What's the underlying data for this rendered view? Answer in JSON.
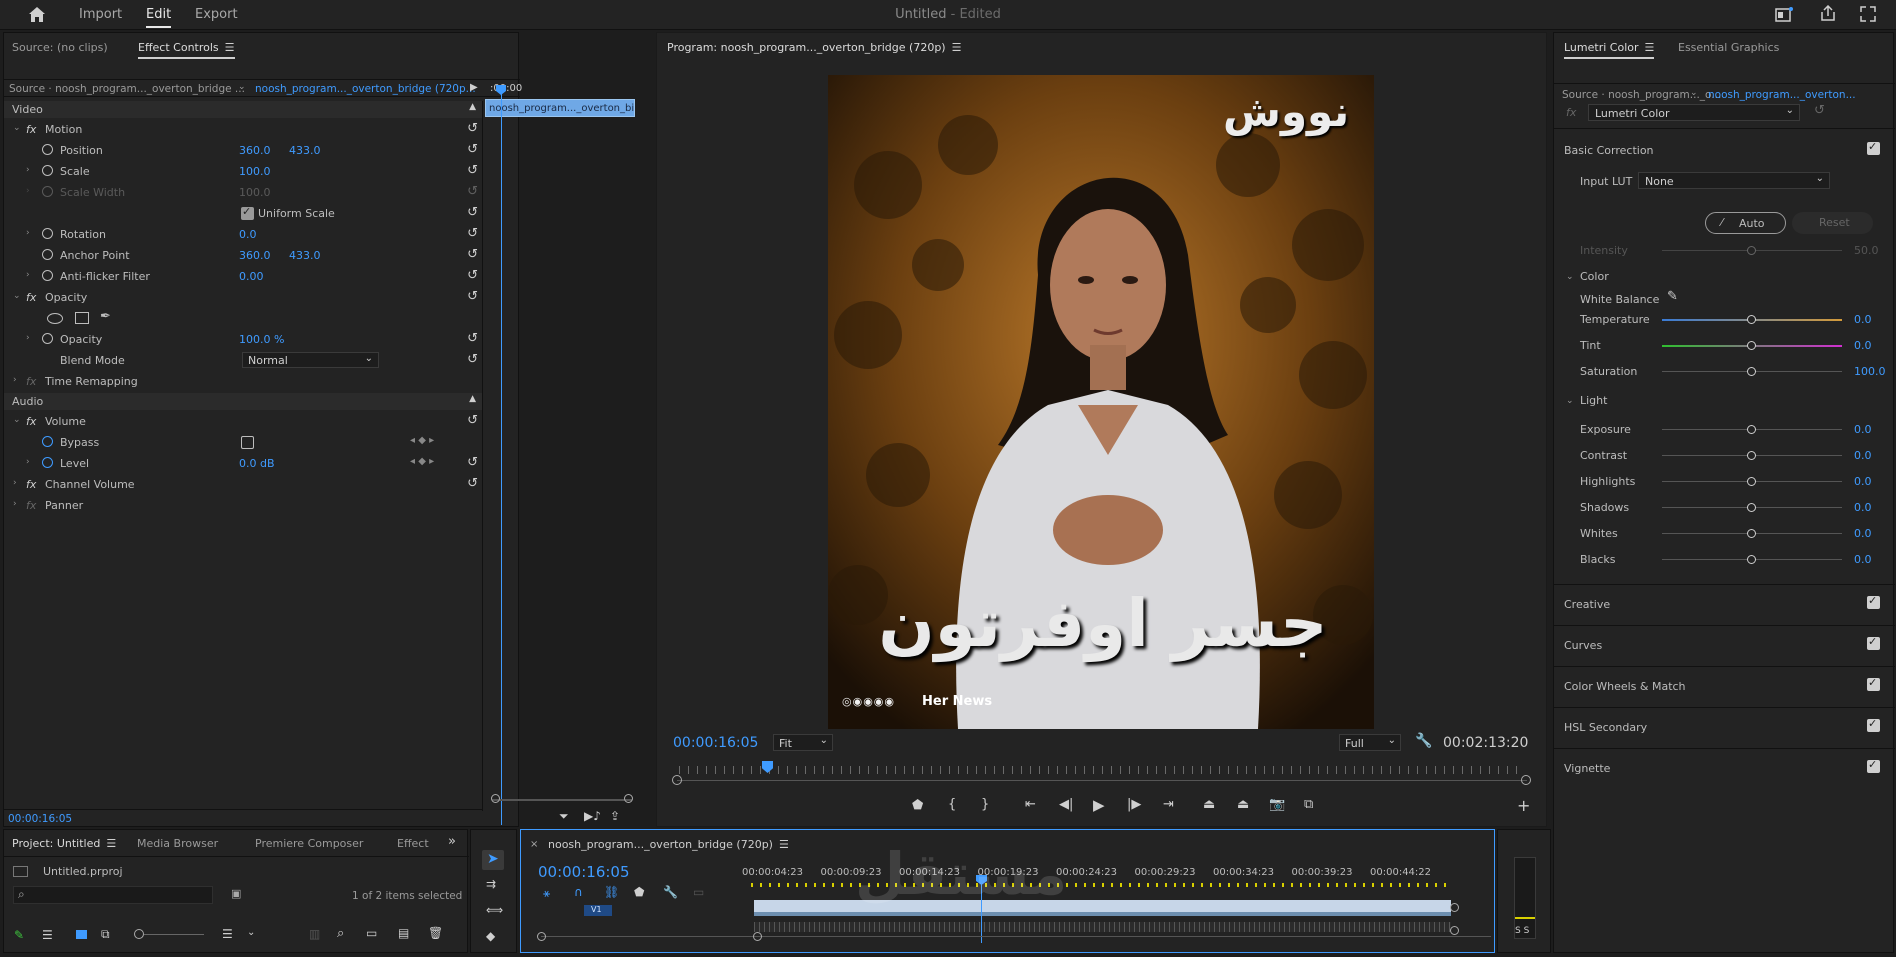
{
  "topbar": {
    "nav": [
      "Import",
      "Edit",
      "Export"
    ],
    "title": "Untitled",
    "edited": " - Edited"
  },
  "effect_controls": {
    "tab_source": "Source: (no clips)",
    "tab_effect": "Effect Controls",
    "source_label": "Source · noosh_program..._overton_bridge ...",
    "sequence_label": "noosh_program..._overton_bridge (720p...",
    "timecode_ruler": ":00:00",
    "clip_name": "noosh_program..._overton_bi",
    "video_header": "Video",
    "audio_header": "Audio",
    "motion": "Motion",
    "position_label": "Position",
    "position_x": "360.0",
    "position_y": "433.0",
    "scale_label": "Scale",
    "scale_val": "100.0",
    "scale_width_label": "Scale Width",
    "scale_width_val": "100.0",
    "uniform_scale": "Uniform Scale",
    "rotation_label": "Rotation",
    "rotation_val": "0.0",
    "anchor_label": "Anchor Point",
    "anchor_x": "360.0",
    "anchor_y": "433.0",
    "antiflicker_label": "Anti-flicker Filter",
    "antiflicker_val": "0.00",
    "opacity_head": "Opacity",
    "opacity_label": "Opacity",
    "opacity_val": "100.0 %",
    "blend_label": "Blend Mode",
    "blend_val": "Normal",
    "time_remap": "Time Remapping",
    "volume": "Volume",
    "bypass": "Bypass",
    "level_label": "Level",
    "level_val": "0.0 dB",
    "channel_volume": "Channel Volume",
    "panner": "Panner",
    "bottom_timecode": "00:00:16:05"
  },
  "program": {
    "title": "Program: noosh_program..._overton_bridge (720p)",
    "timecode": "00:00:16:05",
    "fit": "Fit",
    "full": "Full",
    "duration": "00:02:13:20",
    "overlay_logo": "نووش",
    "overlay_title": "جسر اوفرتون",
    "overlay_credit": "Her News"
  },
  "lumetri": {
    "tab_lumetri": "Lumetri Color",
    "tab_essential": "Essential Graphics",
    "source_label": "Source · noosh_program..._o...",
    "sequence_label": "noosh_program..._overton...",
    "effect_select": "Lumetri Color",
    "basic_correction": "Basic Correction",
    "input_lut_label": "Input LUT",
    "input_lut_val": "None",
    "auto": "Auto",
    "reset": "Reset",
    "intensity_label": "Intensity",
    "intensity_val": "50.0",
    "color_head": "Color",
    "white_balance": "White Balance",
    "light_head": "Light",
    "sliders": [
      {
        "label": "Temperature",
        "value": "0.0"
      },
      {
        "label": "Tint",
        "value": "0.0"
      },
      {
        "label": "Saturation",
        "value": "100.0"
      },
      {
        "label": "Exposure",
        "value": "0.0"
      },
      {
        "label": "Contrast",
        "value": "0.0"
      },
      {
        "label": "Highlights",
        "value": "0.0"
      },
      {
        "label": "Shadows",
        "value": "0.0"
      },
      {
        "label": "Whites",
        "value": "0.0"
      },
      {
        "label": "Blacks",
        "value": "0.0"
      }
    ],
    "sections": [
      "Creative",
      "Curves",
      "Color Wheels & Match",
      "HSL Secondary",
      "Vignette"
    ]
  },
  "project": {
    "tabs": [
      "Project: Untitled",
      "Media Browser",
      "Premiere Composer",
      "Effect"
    ],
    "file": "Untitled.prproj",
    "selection": "1 of 2 items selected"
  },
  "timeline": {
    "seq_name": "noosh_program..._overton_bridge (720p)",
    "timecode": "00:00:16:05",
    "ruler": [
      "00:00:04:23",
      "00:00:09:23",
      "00:00:14:23",
      "00:00:19:23",
      "00:00:24:23",
      "00:00:29:23",
      "00:00:34:23",
      "00:00:39:23",
      "00:00:44:22"
    ],
    "track_v1": "V1",
    "meter_label": "S S"
  },
  "watermark": "مستقل"
}
